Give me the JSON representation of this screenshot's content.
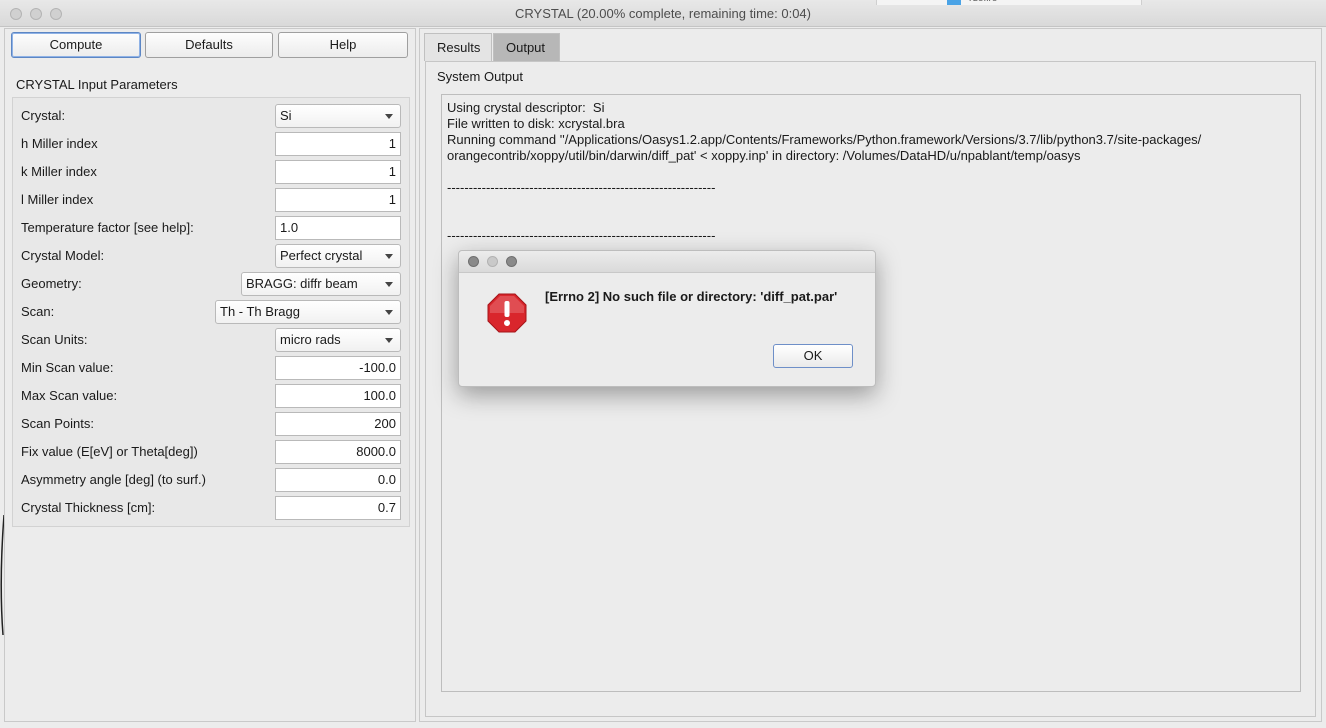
{
  "window": {
    "title": "CRYSTAL (20.00% complete, remaining time: 0:04)"
  },
  "background_window": {
    "peek_text": "rdefire"
  },
  "toolbar": {
    "compute_label": "Compute",
    "defaults_label": "Defaults",
    "help_label": "Help"
  },
  "params": {
    "group_title": "CRYSTAL Input Parameters",
    "crystal": {
      "label": "Crystal:",
      "value": "Si"
    },
    "h_miller": {
      "label": "h Miller index",
      "value": "1"
    },
    "k_miller": {
      "label": "k Miller index",
      "value": "1"
    },
    "l_miller": {
      "label": "l Miller index",
      "value": "1"
    },
    "temp_factor": {
      "label": "Temperature factor [see help]:",
      "value": "1.0"
    },
    "crystal_model": {
      "label": "Crystal Model:",
      "value": "Perfect crystal"
    },
    "geometry": {
      "label": "Geometry:",
      "value": "BRAGG: diffr beam"
    },
    "scan": {
      "label": "Scan:",
      "value": "Th - Th Bragg"
    },
    "scan_units": {
      "label": "Scan Units:",
      "value": "micro rads"
    },
    "min_scan": {
      "label": "Min Scan value:",
      "value": "-100.0"
    },
    "max_scan": {
      "label": "Max Scan value:",
      "value": "100.0"
    },
    "scan_points": {
      "label": "Scan Points:",
      "value": "200"
    },
    "fix_value": {
      "label": "Fix value (E[eV] or Theta[deg])",
      "value": "8000.0"
    },
    "asymmetry": {
      "label": "Asymmetry angle [deg] (to surf.)",
      "value": "0.0"
    },
    "thickness": {
      "label": "Crystal Thickness [cm]:",
      "value": "0.7"
    }
  },
  "tabs": {
    "results": "Results",
    "output": "Output"
  },
  "output": {
    "title": "System Output",
    "text": "Using crystal descriptor:  Si\nFile written to disk: xcrystal.bra\nRunning command ''/Applications/Oasys1.2.app/Contents/Frameworks/Python.framework/Versions/3.7/lib/python3.7/site-packages/\norangecontrib/xoppy/util/bin/darwin/diff_pat' < xoppy.inp' in directory: /Volumes/DataHD/u/npablant/temp/oasys\n\n--------------------------------------------------------------\n\n\n--------------------------------------------------------------"
  },
  "dialog": {
    "message": "[Errno 2] No such file or directory: 'diff_pat.par'",
    "ok_label": "OK",
    "icon": "error-icon"
  },
  "colors": {
    "error_red": "#d9262c",
    "tab_selected": "#b7b7b7",
    "focus_blue": "#5c86c4"
  }
}
